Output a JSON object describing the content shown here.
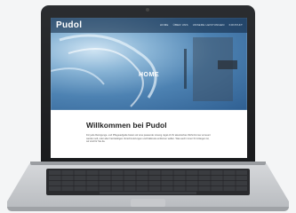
{
  "site": {
    "brand": "Pudol",
    "nav": [
      "HOME",
      "ÜBER UNS",
      "UNSERE LEISTUNGEN",
      "KONTAKT"
    ],
    "hero_title": "HOME",
    "welcome_heading": "Willkommen bei Pudol",
    "intro_text": "Für jede Reinigungs- und Pflegeaufgabe bieten wir eine passende Lösung. Egal ob Ihr akustisches Wohnzimmer erneuert werden soll, oder aber hartnäckigen Verschmutzungen und Kalkreste entfernen wollen. Was auch immer Ihr Anliegen ist, wir sind für Sie da."
  }
}
